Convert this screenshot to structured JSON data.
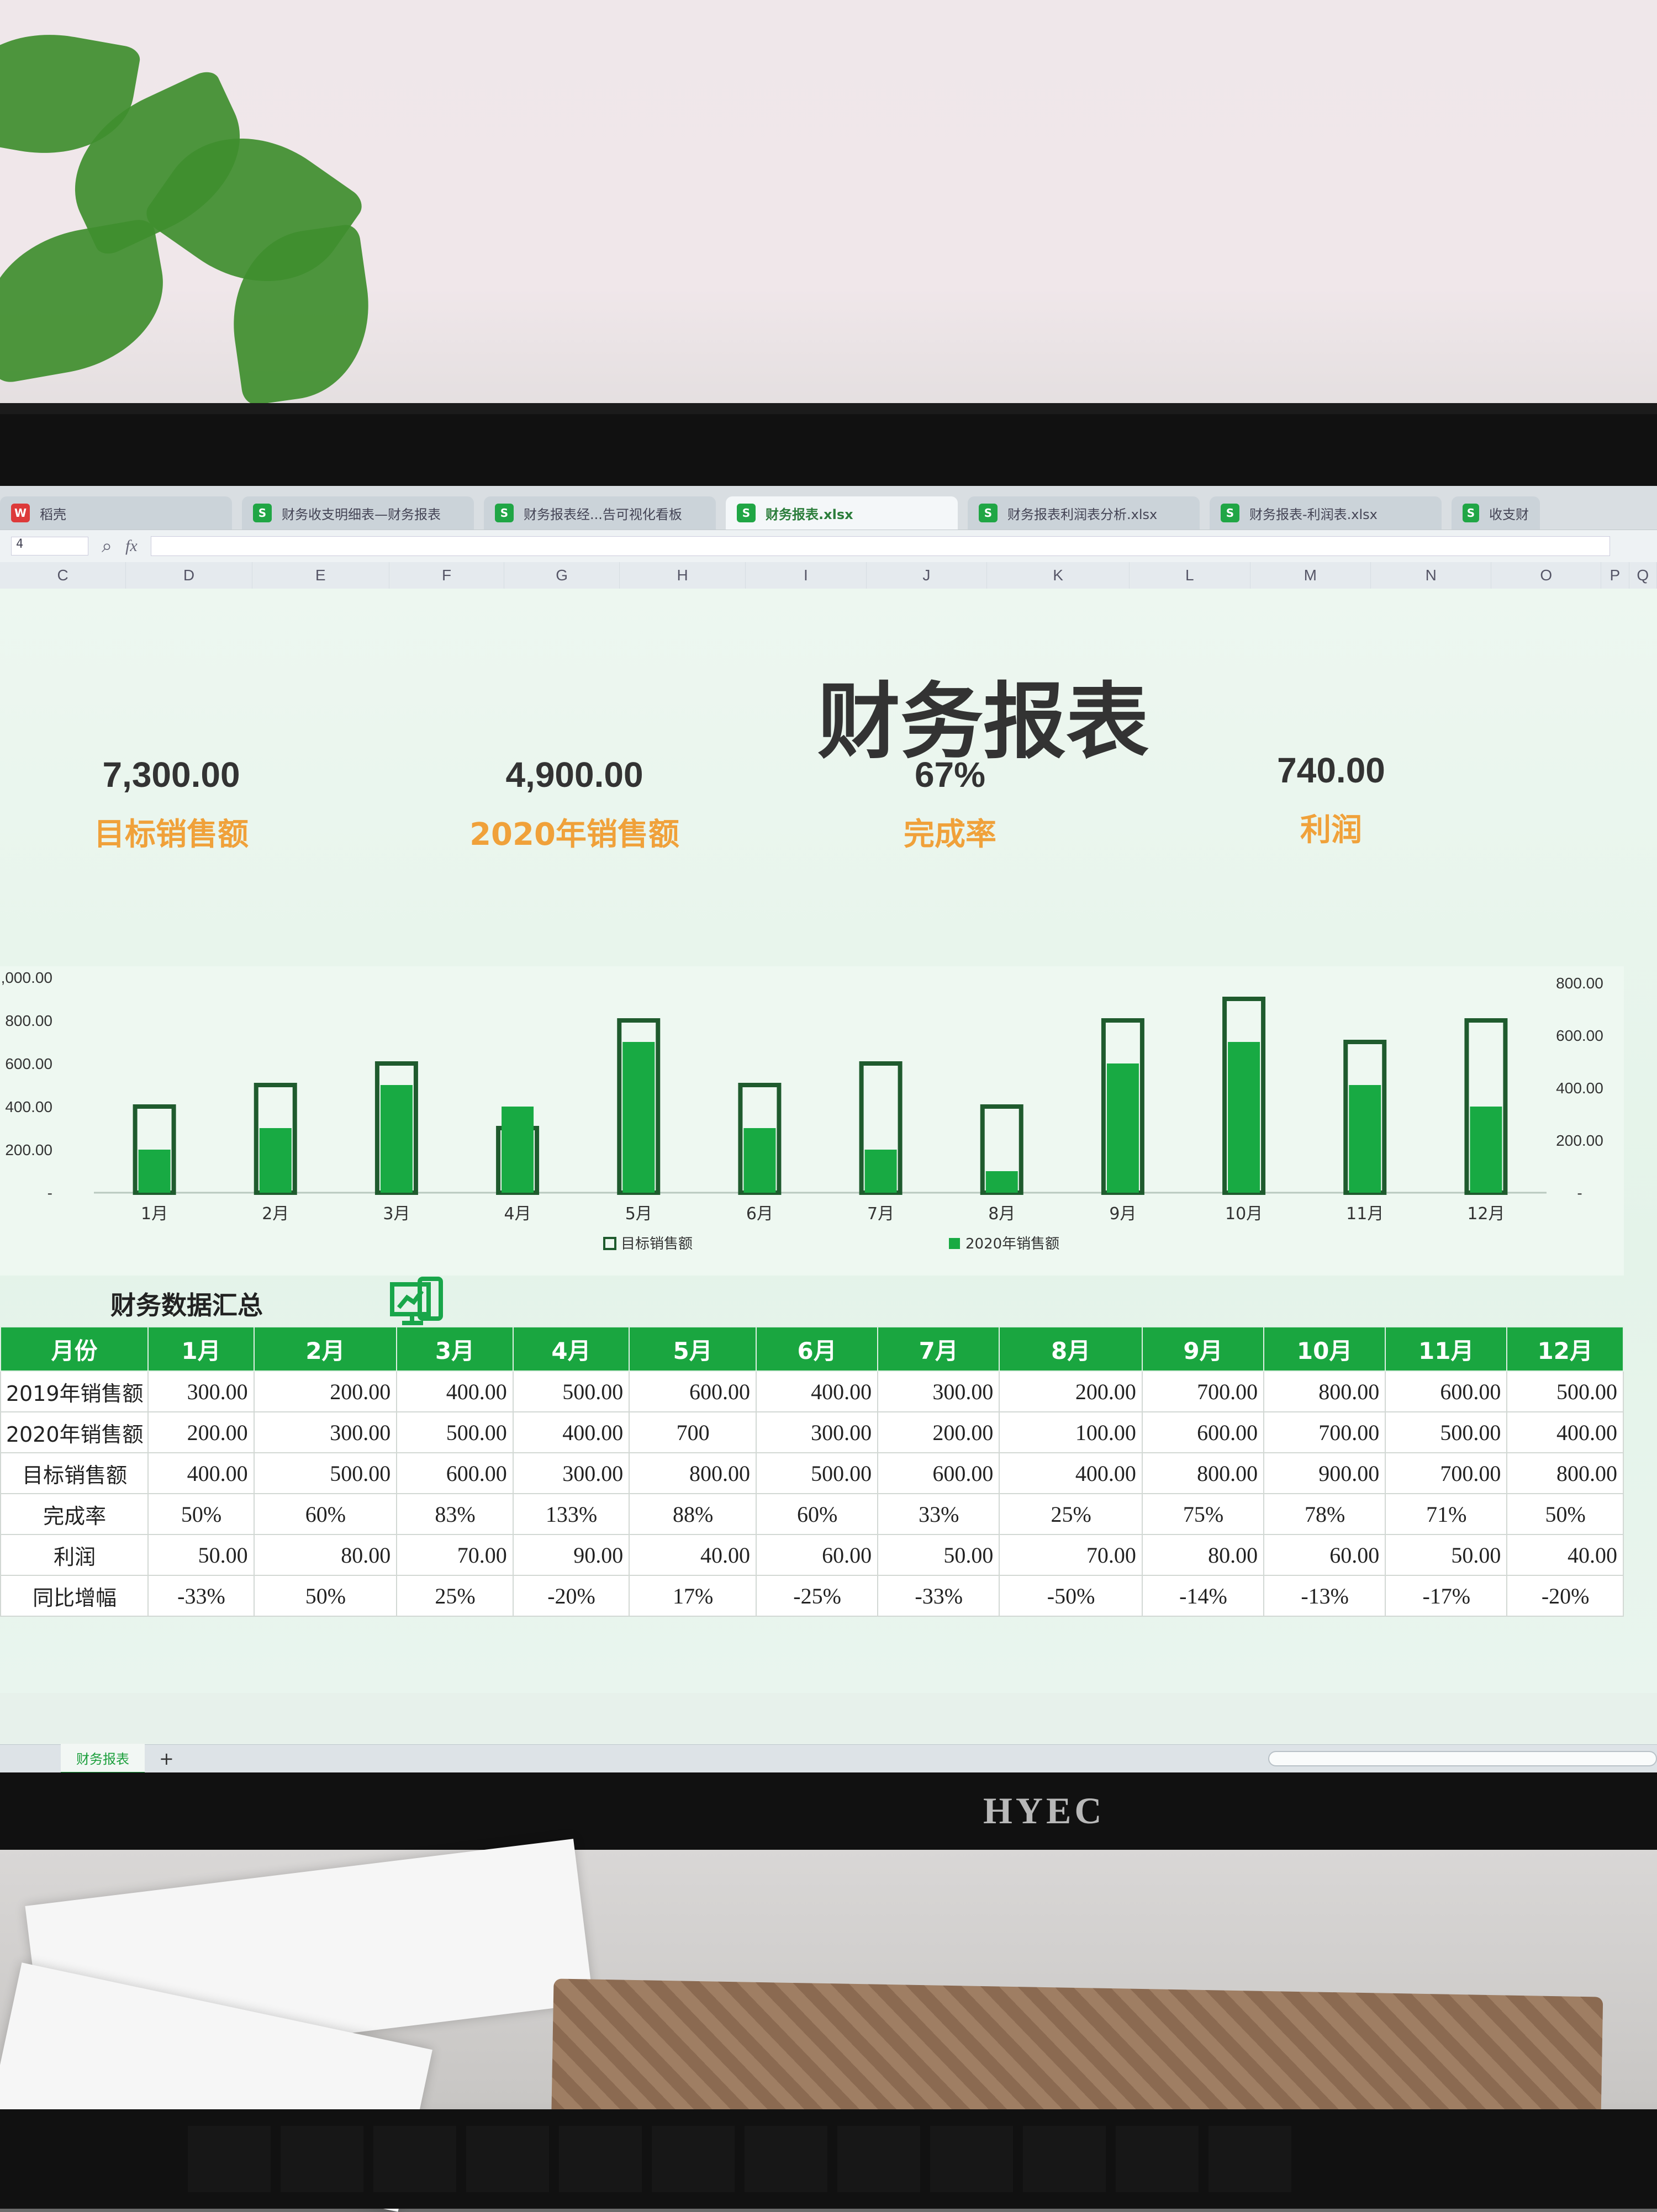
{
  "window": {
    "tabs": [
      {
        "label": "稻壳",
        "icon": "wps-logo-icon",
        "active": false
      },
      {
        "label": "财务收支明细表—财务报表",
        "icon": "spreadsheet-icon",
        "active": false
      },
      {
        "label": "财务报表经...告可视化看板",
        "icon": "spreadsheet-icon",
        "active": false
      },
      {
        "label": "财务报表.xlsx",
        "icon": "spreadsheet-icon",
        "active": true
      },
      {
        "label": "财务报表利润表分析.xlsx",
        "icon": "spreadsheet-icon",
        "active": false
      },
      {
        "label": "财务报表-利润表.xlsx",
        "icon": "spreadsheet-icon",
        "active": false
      },
      {
        "label": "收支财",
        "icon": "spreadsheet-icon",
        "active": false
      }
    ],
    "namebox": "4",
    "fx_label": "fx",
    "columns": [
      "C",
      "D",
      "E",
      "F",
      "G",
      "H",
      "I",
      "J",
      "K",
      "L",
      "M",
      "N",
      "O",
      "P",
      "Q"
    ],
    "sheet_tab": "财务报表",
    "sheet_add": "+",
    "brand": "HYEC"
  },
  "report": {
    "title": "财务报表",
    "kpis": [
      {
        "value": "7,300.00",
        "label": "目标销售额"
      },
      {
        "value": "4,900.00",
        "label": "2020年销售额"
      },
      {
        "value": "67%",
        "label": "完成率"
      },
      {
        "value": "740.00",
        "label": "利润"
      }
    ],
    "section_title": "财务数据汇总",
    "table": {
      "headers": [
        "月份",
        "1月",
        "2月",
        "3月",
        "4月",
        "5月",
        "6月",
        "7月",
        "8月",
        "9月",
        "10月",
        "11月",
        "12月"
      ],
      "rows": [
        [
          "2019年销售额",
          "300.00",
          "200.00",
          "400.00",
          "500.00",
          "600.00",
          "400.00",
          "300.00",
          "200.00",
          "700.00",
          "800.00",
          "600.00",
          "500.00"
        ],
        [
          "2020年销售额",
          "200.00",
          "300.00",
          "500.00",
          "400.00",
          "700",
          "300.00",
          "200.00",
          "100.00",
          "600.00",
          "700.00",
          "500.00",
          "400.00"
        ],
        [
          "目标销售额",
          "400.00",
          "500.00",
          "600.00",
          "300.00",
          "800.00",
          "500.00",
          "600.00",
          "400.00",
          "800.00",
          "900.00",
          "700.00",
          "800.00"
        ],
        [
          "完成率",
          "50%",
          "60%",
          "83%",
          "133%",
          "88%",
          "60%",
          "33%",
          "25%",
          "75%",
          "78%",
          "71%",
          "50%"
        ],
        [
          "利润",
          "50.00",
          "80.00",
          "70.00",
          "90.00",
          "40.00",
          "60.00",
          "50.00",
          "70.00",
          "80.00",
          "60.00",
          "50.00",
          "40.00"
        ],
        [
          "同比增幅",
          "-33%",
          "50%",
          "25%",
          "-20%",
          "17%",
          "-25%",
          "-33%",
          "-50%",
          "-14%",
          "-13%",
          "-17%",
          "-20%"
        ]
      ]
    }
  },
  "chart_data": {
    "type": "bar",
    "categories": [
      "1月",
      "2月",
      "3月",
      "4月",
      "5月",
      "6月",
      "7月",
      "8月",
      "9月",
      "10月",
      "11月",
      "12月"
    ],
    "series": [
      {
        "name": "目标销售额",
        "values": [
          400,
          500,
          600,
          300,
          800,
          500,
          600,
          400,
          800,
          900,
          700,
          800
        ],
        "style": "outline"
      },
      {
        "name": "2020年销售额",
        "values": [
          200,
          300,
          500,
          400,
          700,
          300,
          200,
          100,
          600,
          700,
          500,
          400
        ],
        "style": "filled"
      }
    ],
    "left_axis": {
      "ticks": [
        "-",
        "200.00",
        "400.00",
        "600.00",
        "800.00",
        ",000.00"
      ],
      "ylim": [
        0,
        1000
      ]
    },
    "right_axis": {
      "ticks": [
        "-",
        "200.00",
        "400.00",
        "600.00",
        "800.00"
      ]
    },
    "legend": [
      "目标销售额",
      "2020年销售额"
    ],
    "legend_position": "bottom",
    "colors": {
      "outline": "#1f5b2e",
      "fill": "#18aa43"
    }
  }
}
